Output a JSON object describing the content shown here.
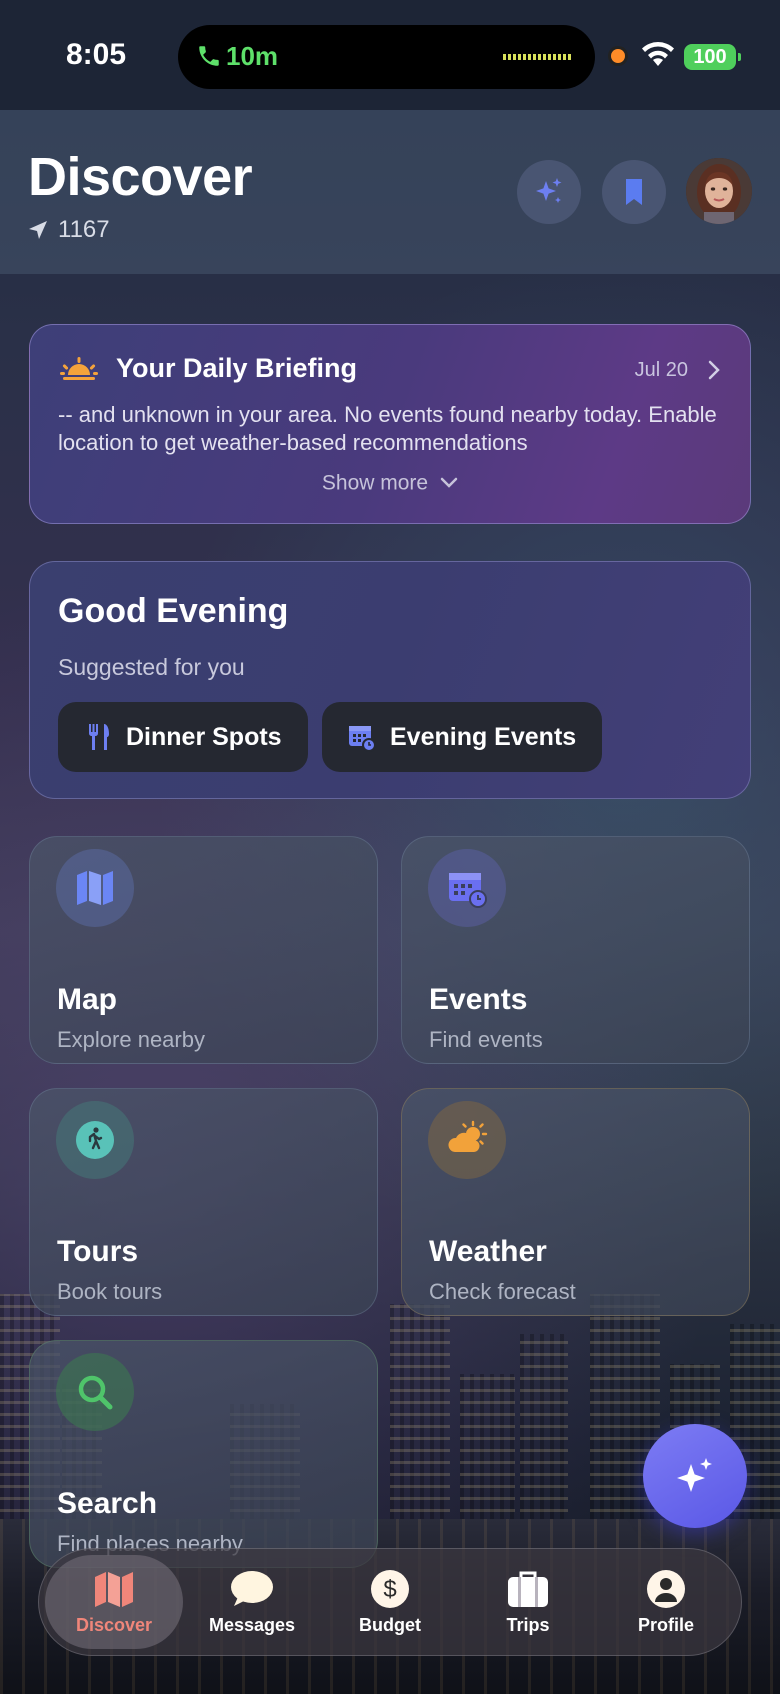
{
  "status_bar": {
    "time": "8:05",
    "call_duration": "10m",
    "battery": "100"
  },
  "header": {
    "title": "Discover",
    "location_text": "1167",
    "buttons": [
      "sparkles-icon",
      "bookmark-icon"
    ],
    "accent_color": "#5b7cf0"
  },
  "briefing": {
    "title": "Your Daily Briefing",
    "date": "Jul 20",
    "text": "-- and unknown in your area. No events found nearby today. Enable location to get weather-based recommendations",
    "show_more": "Show more"
  },
  "evening": {
    "title": "Good Evening",
    "subtitle": "Suggested for you",
    "chips": [
      {
        "label": "Dinner Spots",
        "icon": "fork-knife-icon"
      },
      {
        "label": "Evening Events",
        "icon": "calendar-clock-icon"
      }
    ]
  },
  "tiles": [
    {
      "name": "Map",
      "subtitle": "Explore nearby",
      "icon": "map-icon",
      "color": "#6b86f5"
    },
    {
      "name": "Events",
      "subtitle": "Find events",
      "icon": "calendar-icon",
      "color": "#6a6ff0"
    },
    {
      "name": "Tours",
      "subtitle": "Book tours",
      "icon": "walking-person-icon",
      "color": "#59c2b8"
    },
    {
      "name": "Weather",
      "subtitle": "Check forecast",
      "icon": "sun-cloud-icon",
      "color": "#f2a23a"
    },
    {
      "name": "Search",
      "subtitle": "Find places nearby",
      "icon": "magnifier-icon",
      "color": "#4fc46a"
    }
  ],
  "tabbar": {
    "items": [
      {
        "label": "Discover",
        "icon": "map-icon",
        "active": true
      },
      {
        "label": "Messages",
        "icon": "chat-bubble-icon",
        "active": false
      },
      {
        "label": "Budget",
        "icon": "dollar-circle-icon",
        "active": false
      },
      {
        "label": "Trips",
        "icon": "suitcase-icon",
        "active": false
      },
      {
        "label": "Profile",
        "icon": "person-circle-icon",
        "active": false
      }
    ],
    "active_color": "#f0867a"
  }
}
